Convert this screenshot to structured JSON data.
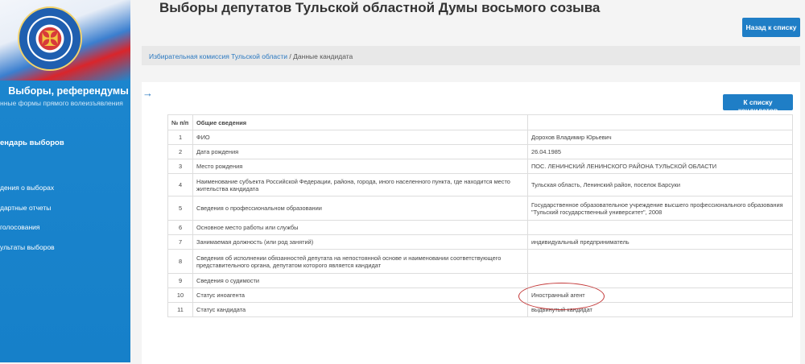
{
  "sidebar": {
    "title": "Выборы, референдумы",
    "subtitle": "нные формы прямого волеизъявления",
    "calendar": "ендарь выборов",
    "links": [
      "дения о выборах",
      "дартные отчеты",
      "голосования",
      "ультаты выборов"
    ]
  },
  "header": {
    "title": "Выборы депутатов Тульской областной Думы восьмого созыва",
    "back_button": "Назад к списку"
  },
  "breadcrumb": {
    "link": "Избирательная комиссия Тульской области",
    "separator": "/",
    "current": "Данные кандидата"
  },
  "candidates_button": "К списку кандидатов",
  "table": {
    "headers": [
      "№ п/п",
      "Общие сведения",
      ""
    ],
    "rows": [
      {
        "n": "1",
        "label": "ФИО",
        "value": "Дорохов Владимир Юрьевич"
      },
      {
        "n": "2",
        "label": "Дата рождения",
        "value": "26.04.1985"
      },
      {
        "n": "3",
        "label": "Место рождения",
        "value": "ПОС. ЛЕНИНСКИЙ ЛЕНИНСКОГО РАЙОНА ТУЛЬСКОЙ ОБЛАСТИ"
      },
      {
        "n": "4",
        "label": "Наименование субъекта Российской Федерации, района, города, иного населенного пункта, где находится место жительства кандидата",
        "value": "Тульская область, Ленинский район, поселок Барсуки"
      },
      {
        "n": "5",
        "label": "Сведения о профессиональном образовании",
        "value": "Государственное образовательное учреждение высшего профессионального образования \"Тульский государственный университет\", 2008"
      },
      {
        "n": "6",
        "label": "Основное место работы или службы",
        "value": ""
      },
      {
        "n": "7",
        "label": "Занимаемая должность (или род занятий)",
        "value": "индивидуальный предприниматель"
      },
      {
        "n": "8",
        "label": "Сведения об исполнении обязанностей депутата на непостоянной основе и наименовании соответствующего представительного органа, депутатом которого является кандидат",
        "value": ""
      },
      {
        "n": "9",
        "label": "Сведения о судимости",
        "value": ""
      },
      {
        "n": "10",
        "label": "Статус иноагента",
        "value": "Иностранный агент"
      },
      {
        "n": "11",
        "label": "Статус кандидата",
        "value": "выдвинутый кандидат"
      }
    ]
  }
}
